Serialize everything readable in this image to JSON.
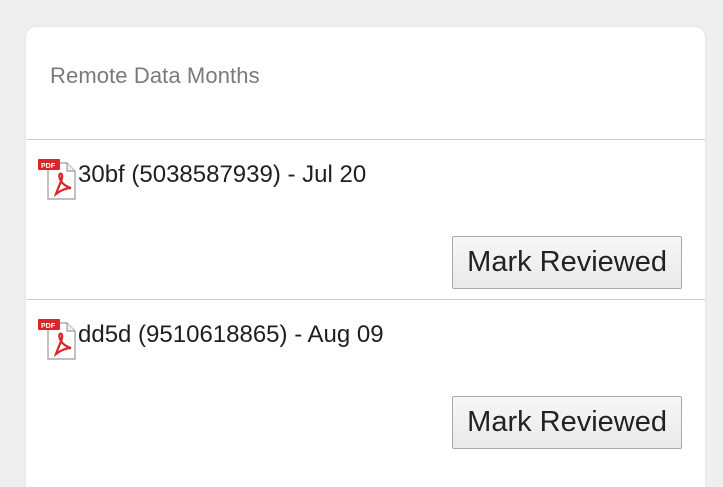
{
  "panel": {
    "title": "Remote Data Months"
  },
  "entries": [
    {
      "icon": "pdf-file-icon",
      "text": "30bf (5038587939) - Jul 20",
      "button_label": "Mark Reviewed"
    },
    {
      "icon": "pdf-file-icon",
      "text": "dd5d (9510618865) - Aug 09",
      "button_label": "Mark Reviewed"
    }
  ],
  "colors": {
    "pdf_red": "#d9262b",
    "background": "#efefef",
    "panel": "#ffffff",
    "title_text": "#7a7a7a"
  }
}
